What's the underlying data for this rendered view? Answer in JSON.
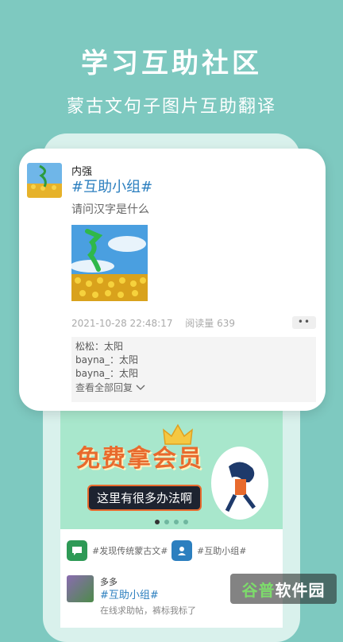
{
  "headline": "学习互助社区",
  "subhead": "蒙古文句子图片互助翻译",
  "card": {
    "author": "内强",
    "topic": "#互助小组#",
    "question": "请问汉字是什么",
    "timestamp": "2021-10-28 22:48:17",
    "views": "阅读量 639",
    "more_label": "••",
    "replies": [
      "松松：太阳",
      "bayna_：太阳",
      "bayna_：太阳"
    ],
    "view_all": "查看全部回复"
  },
  "banner": {
    "title": "免费拿会员",
    "pill": "这里有很多办法啊",
    "dots": 4,
    "active_dot": 1
  },
  "tags": [
    {
      "label": "#发现传统蒙古文#",
      "icon": "chat-bubble-icon",
      "color": "#2e9a56"
    },
    {
      "label": "#互助小组#",
      "icon": "user-card-icon",
      "color": "#2c7fbf"
    }
  ],
  "post2": {
    "author": "多多",
    "topic": "#互助小组#",
    "body": "在线求助帖，裤标我标了"
  },
  "watermark": {
    "part1": "谷普",
    "part2": "软件园"
  }
}
